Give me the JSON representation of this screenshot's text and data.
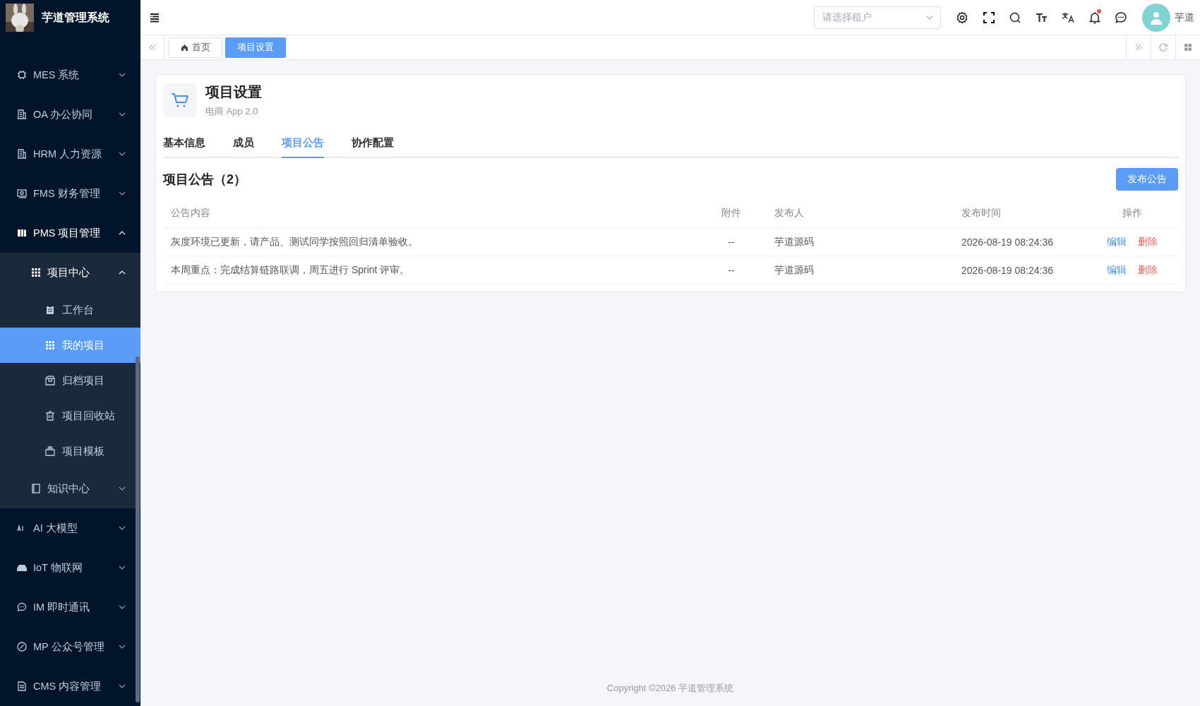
{
  "app": {
    "title": "芋道管理系统"
  },
  "sidebar": {
    "items": [
      {
        "label": "MES 系统",
        "selected": false,
        "expanded": false
      },
      {
        "label": "OA 办公协同",
        "selected": false,
        "expanded": false
      },
      {
        "label": "HRM 人力资源",
        "selected": false,
        "expanded": false
      },
      {
        "label": "FMS 财务管理",
        "selected": false,
        "expanded": false
      },
      {
        "label": "PMS 项目管理",
        "selected": false,
        "expanded": true,
        "children": [
          {
            "label": "项目中心",
            "selected": false,
            "expanded": true,
            "children": [
              {
                "label": "工作台",
                "selected": false
              },
              {
                "label": "我的项目",
                "selected": true
              },
              {
                "label": "归档项目",
                "selected": false
              },
              {
                "label": "项目回收站",
                "selected": false
              },
              {
                "label": "项目模板",
                "selected": false
              }
            ]
          },
          {
            "label": "知识中心",
            "selected": false,
            "expanded": false
          }
        ]
      },
      {
        "label": "AI 大模型",
        "selected": false,
        "expanded": false
      },
      {
        "label": "IoT 物联网",
        "selected": false,
        "expanded": false
      },
      {
        "label": "IM 即时通讯",
        "selected": false,
        "expanded": false
      },
      {
        "label": "MP 公众号管理",
        "selected": false,
        "expanded": false
      },
      {
        "label": "CMS 内容管理",
        "selected": false,
        "expanded": false
      }
    ]
  },
  "header": {
    "tenant_select": {
      "placeholder": "请选择租户"
    },
    "notifications": {
      "unread": true
    },
    "user": {
      "name": "芋道"
    }
  },
  "tags": [
    {
      "label": "首页",
      "selected": false
    },
    {
      "label": "项目设置",
      "selected": true
    }
  ],
  "project": {
    "title": "项目设置",
    "subtitle": "电商 App 2.0"
  },
  "tabs": [
    {
      "label": "基本信息",
      "selected": false
    },
    {
      "label": "成员",
      "selected": false
    },
    {
      "label": "项目公告",
      "selected": true
    },
    {
      "label": "协作配置",
      "selected": false
    }
  ],
  "section": {
    "title": "项目公告（2）",
    "button": "发布公告"
  },
  "table": {
    "columns": [
      "公告内容",
      "附件",
      "发布人",
      "发布时间",
      "操作"
    ],
    "rows": [
      {
        "content": "灰度环境已更新，请产品、测试同学按照回归清单验收。",
        "attachment": "--",
        "publisher": "芋道源码",
        "time": "2026-08-19 08:24:36",
        "actions": [
          {
            "label": "编辑",
            "kind": "edit"
          },
          {
            "label": "删除",
            "kind": "delete"
          }
        ]
      },
      {
        "content": "本周重点：完成结算链路联调，周五进行 Sprint 评审。",
        "attachment": "--",
        "publisher": "芋道源码",
        "time": "2026-08-19 08:24:36",
        "actions": [
          {
            "label": "编辑",
            "kind": "edit"
          },
          {
            "label": "删除",
            "kind": "delete"
          }
        ]
      }
    ]
  },
  "footer": {
    "copyright": "Copyright ©2026 芋道管理系统"
  }
}
